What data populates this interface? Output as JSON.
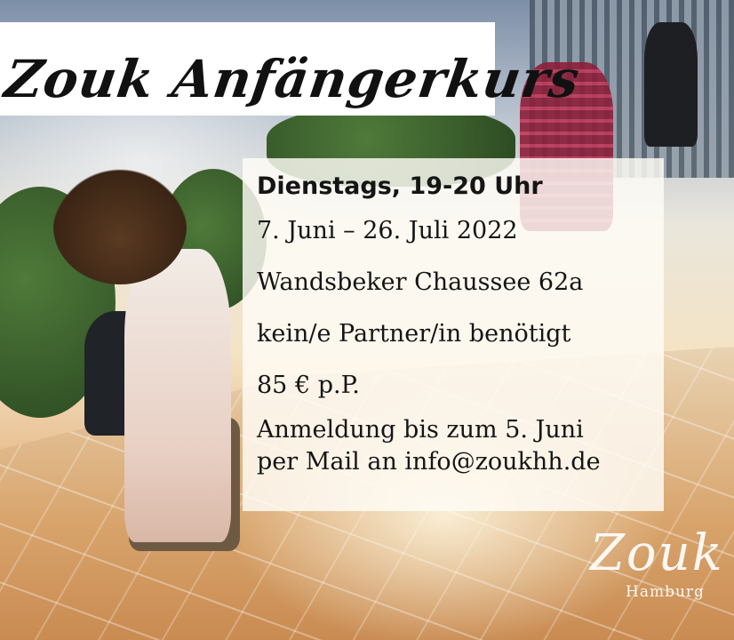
{
  "header": {
    "title": "Zouk Anfängerkurs"
  },
  "details": {
    "schedule": "Dienstags, 19-20 Uhr",
    "dates": "7. Juni – 26. Juli 2022",
    "address": "Wandsbeker Chaussee 62a",
    "partner": "kein/e Partner/in benötigt",
    "price": "85 € p.P.",
    "registration_line1": "Anmeldung bis zum 5. Juni",
    "registration_line2": "per Mail an info@zoukhh.de"
  },
  "logo": {
    "word": "Zouk",
    "subtitle": "Hamburg"
  }
}
